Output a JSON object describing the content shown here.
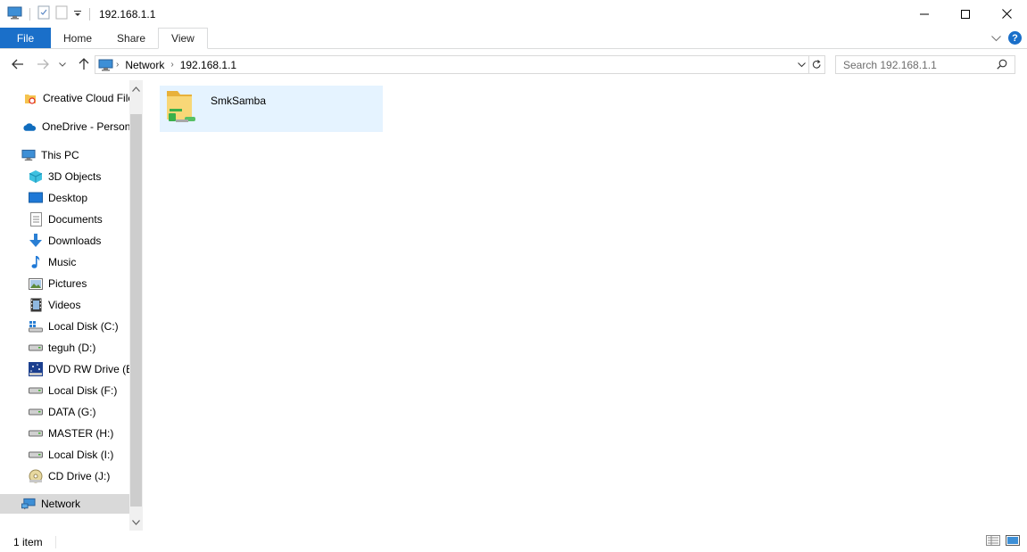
{
  "window": {
    "title": "192.168.1.1",
    "controls": [
      "minimize-icon",
      "maximize-icon",
      "close-icon"
    ]
  },
  "ribbon": {
    "tabs": [
      {
        "label": "File"
      },
      {
        "label": "Home"
      },
      {
        "label": "Share"
      },
      {
        "label": "View"
      }
    ],
    "help_symbol": "?"
  },
  "address_bar": {
    "breadcrumbs": [
      "Network",
      "192.168.1.1"
    ]
  },
  "search": {
    "placeholder": "Search 192.168.1.1"
  },
  "nav_pane": {
    "items": [
      {
        "label": "Creative Cloud Files",
        "icon": "creative-cloud-icon"
      },
      {
        "label": "OneDrive - Personal",
        "icon": "onedrive-icon"
      },
      {
        "label": "This PC",
        "icon": "computer-icon"
      },
      {
        "label": "3D Objects",
        "icon": "3d-objects-icon"
      },
      {
        "label": "Desktop",
        "icon": "desktop-icon"
      },
      {
        "label": "Documents",
        "icon": "documents-icon"
      },
      {
        "label": "Downloads",
        "icon": "downloads-icon"
      },
      {
        "label": "Music",
        "icon": "music-icon"
      },
      {
        "label": "Pictures",
        "icon": "pictures-icon"
      },
      {
        "label": "Videos",
        "icon": "videos-icon"
      },
      {
        "label": "Local Disk (C:)",
        "icon": "system-drive-icon"
      },
      {
        "label": "teguh (D:)",
        "icon": "drive-icon"
      },
      {
        "label": "DVD RW Drive (E:)",
        "icon": "dvd-drive-icon"
      },
      {
        "label": "Local Disk (F:)",
        "icon": "drive-icon"
      },
      {
        "label": "DATA (G:)",
        "icon": "drive-icon"
      },
      {
        "label": "MASTER (H:)",
        "icon": "drive-icon"
      },
      {
        "label": "Local Disk (I:)",
        "icon": "drive-icon"
      },
      {
        "label": "CD Drive (J:)",
        "icon": "cd-drive-icon"
      },
      {
        "label": "Network",
        "icon": "network-icon",
        "selected": true
      }
    ]
  },
  "content": {
    "items": [
      {
        "name": "SmkSamba",
        "icon": "shared-folder-icon"
      }
    ]
  },
  "status_bar": {
    "count_text": "1 item"
  },
  "colors": {
    "file_tab": "#1a6fc9",
    "selected_tile": "#e5f3ff",
    "nav_selected": "#d9d9d9"
  }
}
